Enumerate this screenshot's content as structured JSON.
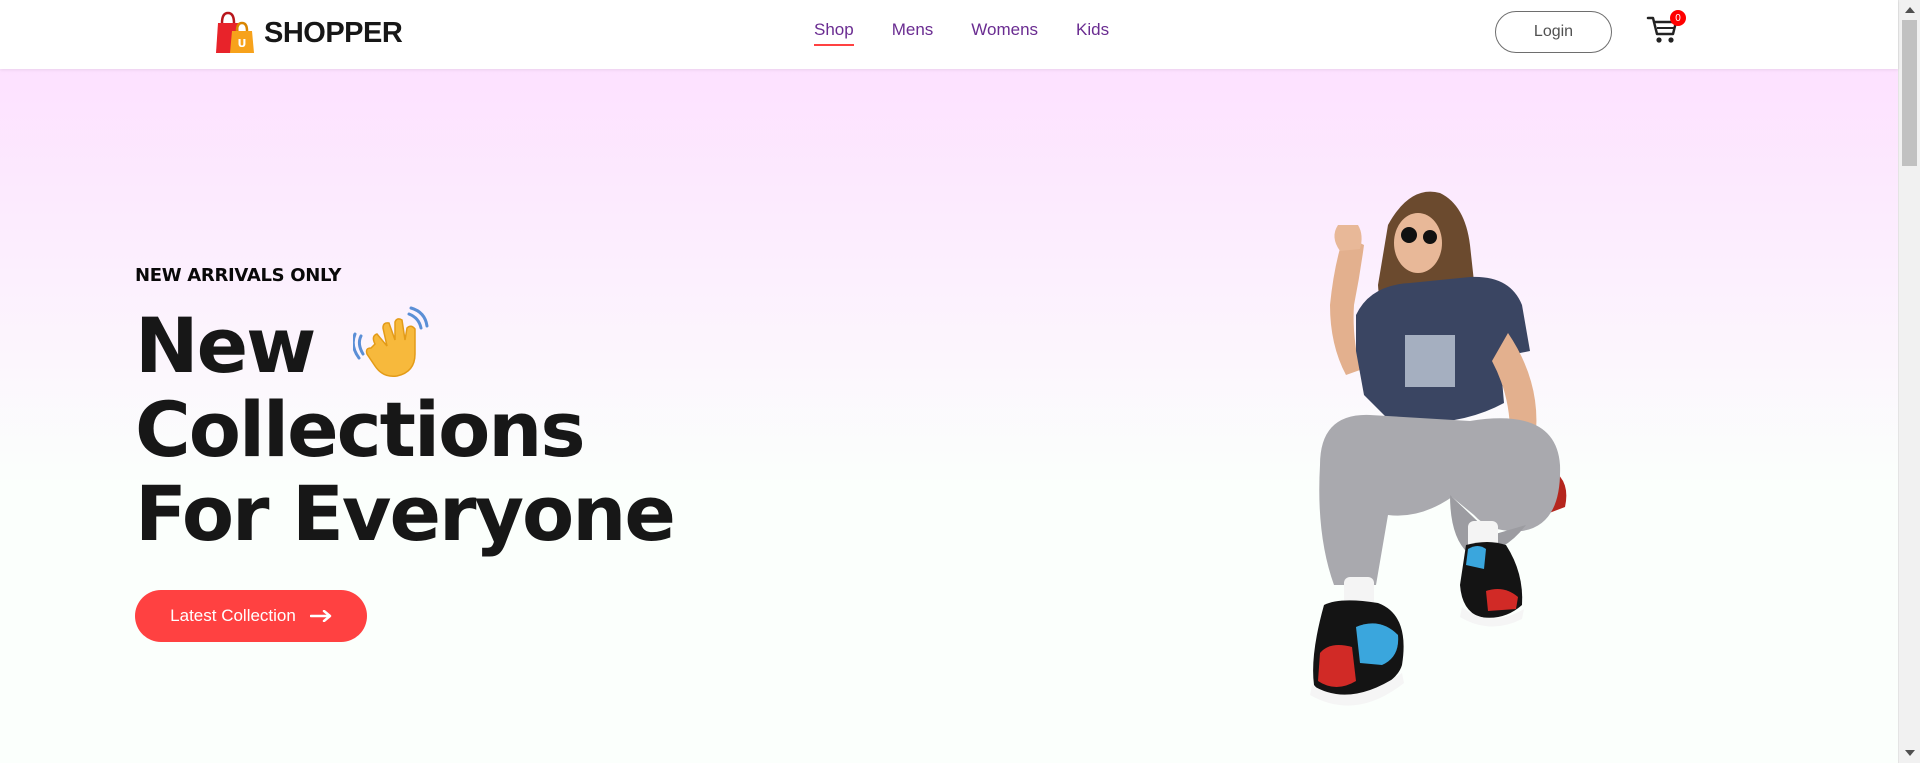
{
  "brand": {
    "name": "SHOPPER",
    "logo_icon": "shopping-bag-icon",
    "colors": {
      "accent": "#ff4141",
      "nav_text": "#6a2c91"
    }
  },
  "nav": {
    "items": [
      {
        "label": "Shop",
        "active": true
      },
      {
        "label": "Mens",
        "active": false
      },
      {
        "label": "Womens",
        "active": false
      },
      {
        "label": "Kids",
        "active": false
      }
    ]
  },
  "header": {
    "login_label": "Login",
    "cart_icon": "cart-icon",
    "cart_count": "0"
  },
  "hero": {
    "tag": "NEW ARRIVALS ONLY",
    "lines": [
      "New",
      "Collections",
      "For Everyone"
    ],
    "hand_icon": "waving-hand-icon",
    "cta_label": "Latest Collection",
    "cta_icon": "arrow-right-icon",
    "image": "hero-model-image"
  }
}
